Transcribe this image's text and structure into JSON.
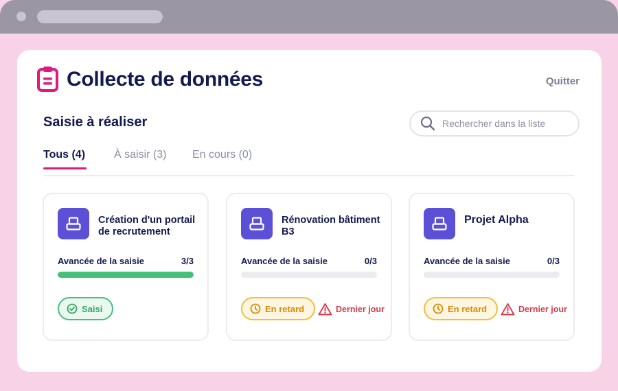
{
  "app": {
    "title": "Collecte de données",
    "quit_label": "Quitter"
  },
  "section": {
    "title": "Saisie à réaliser"
  },
  "search": {
    "placeholder": "Rechercher dans la liste",
    "value": ""
  },
  "tabs": [
    {
      "label": "Tous (4)",
      "active": true
    },
    {
      "label": "À saisir (3)",
      "active": false
    },
    {
      "label": "En cours (0)",
      "active": false
    }
  ],
  "cards": [
    {
      "title": "Création d'un portail de recrutement",
      "progress_label": "Avancée de la saisie",
      "progress_text": "3/3",
      "progress_fraction": 1.0,
      "status_label": "Saisi",
      "status_type": "done",
      "deadline_label": ""
    },
    {
      "title": "Rénovation bâtiment B3",
      "progress_label": "Avancée de la saisie",
      "progress_text": "0/3",
      "progress_fraction": 0.0,
      "status_label": "En retard",
      "status_type": "late",
      "deadline_label": "Dernier jour"
    },
    {
      "title": "Projet Alpha",
      "progress_label": "Avancée de la saisie",
      "progress_text": "0/3",
      "progress_fraction": 0.0,
      "status_label": "En retard",
      "status_type": "late",
      "deadline_label": "Dernier jour"
    }
  ],
  "colors": {
    "accent_pink": "#e0197d",
    "brand_navy": "#131a4f",
    "card_icon_purple": "#5c50d6",
    "success_green": "#45c07a",
    "warning_orange": "#f3bd3d",
    "danger_red": "#d93a4d",
    "page_background": "#f8d3e8"
  },
  "icons": {
    "app": "clipboard-icon",
    "search": "search-icon",
    "card": "project-icon",
    "done": "check-circle-icon",
    "late": "clock-icon",
    "deadline": "warning-triangle-icon"
  }
}
